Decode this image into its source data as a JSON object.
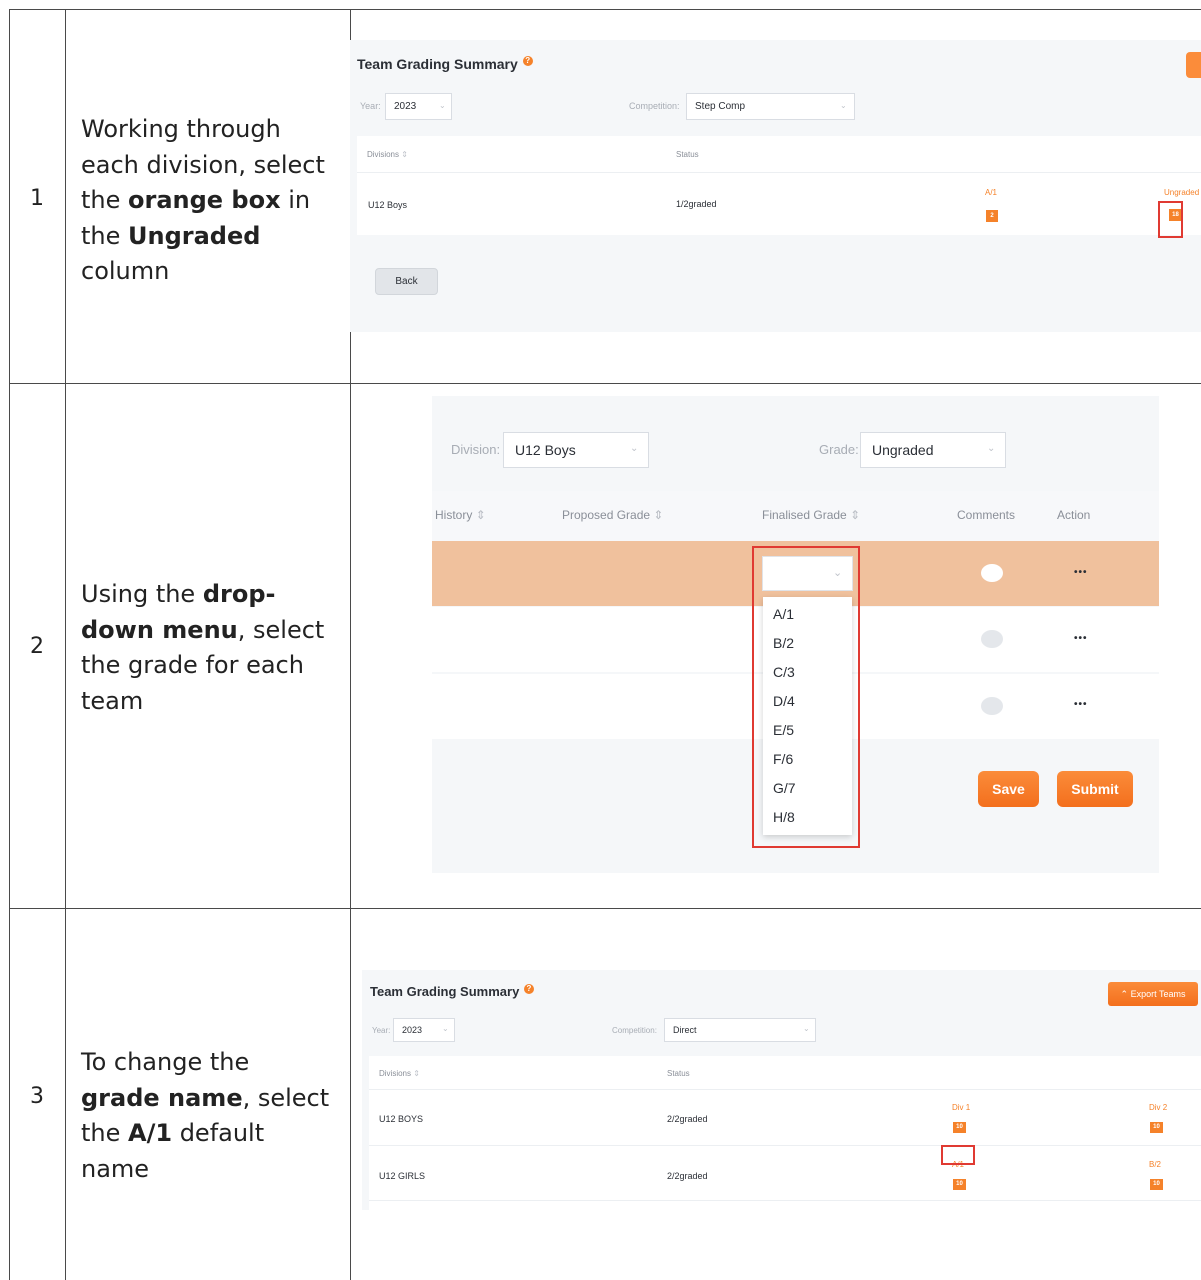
{
  "rows": [
    {
      "number": "1",
      "instruction_parts": [
        {
          "text": "Working through each division, select the ",
          "bold": false
        },
        {
          "text": "orange box",
          "bold": true
        },
        {
          "text": " in the ",
          "bold": false
        },
        {
          "text": "Ungraded",
          "bold": true
        },
        {
          "text": " column",
          "bold": false
        }
      ]
    },
    {
      "number": "2",
      "instruction_parts": [
        {
          "text": "Using the ",
          "bold": false
        },
        {
          "text": "drop-down menu",
          "bold": true
        },
        {
          "text": ", select the grade for each team",
          "bold": false
        }
      ]
    },
    {
      "number": "3",
      "instruction_parts": [
        {
          "text": "To change the ",
          "bold": false
        },
        {
          "text": "grade name",
          "bold": true
        },
        {
          "text": ", select the ",
          "bold": false
        },
        {
          "text": "A/1",
          "bold": true
        },
        {
          "text": " default name",
          "bold": false
        }
      ]
    }
  ],
  "shot1": {
    "title": "Team Grading Summary",
    "help_icon": "?",
    "year_label": "Year:",
    "year_value": "2023",
    "competition_label": "Competition:",
    "competition_value": "Step Comp",
    "col_divisions": "Divisions",
    "col_status": "Status",
    "division": "U12 Boys",
    "status": "1/2graded",
    "grade_label": "A/1",
    "grade_count": "2",
    "ungraded_label": "Ungraded",
    "ungraded_count": "18",
    "back_label": "Back"
  },
  "shot2": {
    "division_label": "Division:",
    "division_value": "U12 Boys",
    "grade_label": "Grade:",
    "grade_value": "Ungraded",
    "col_history": "History",
    "col_proposed": "Proposed Grade",
    "col_finalised": "Finalised Grade",
    "col_comments": "Comments",
    "col_action": "Action",
    "action_dots": "•••",
    "options": [
      "A/1",
      "B/2",
      "C/3",
      "D/4",
      "E/5",
      "F/6",
      "G/7",
      "H/8"
    ],
    "save_label": "Save",
    "submit_label": "Submit"
  },
  "shot3": {
    "title": "Team Grading Summary",
    "help_icon": "?",
    "export_label": "Export Teams",
    "export_icon": "double-chevron-up-icon",
    "year_label": "Year:",
    "year_value": "2023",
    "competition_label": "Competition:",
    "competition_value": "Direct",
    "col_divisions": "Divisions",
    "col_status": "Status",
    "rows": [
      {
        "division": "U12 BOYS",
        "status": "2/2graded",
        "g1_label": "Div 1",
        "g1_count": "10",
        "g2_label": "Div 2",
        "g2_count": "10"
      },
      {
        "division": "U12 GIRLS",
        "status": "2/2graded",
        "g1_label": "A/1",
        "g1_count": "10",
        "g2_label": "B/2",
        "g2_count": "10"
      }
    ]
  },
  "colors": {
    "accent_orange": "#f5822a",
    "highlight_red": "#e03a32",
    "selected_row": "#f0c19d"
  }
}
